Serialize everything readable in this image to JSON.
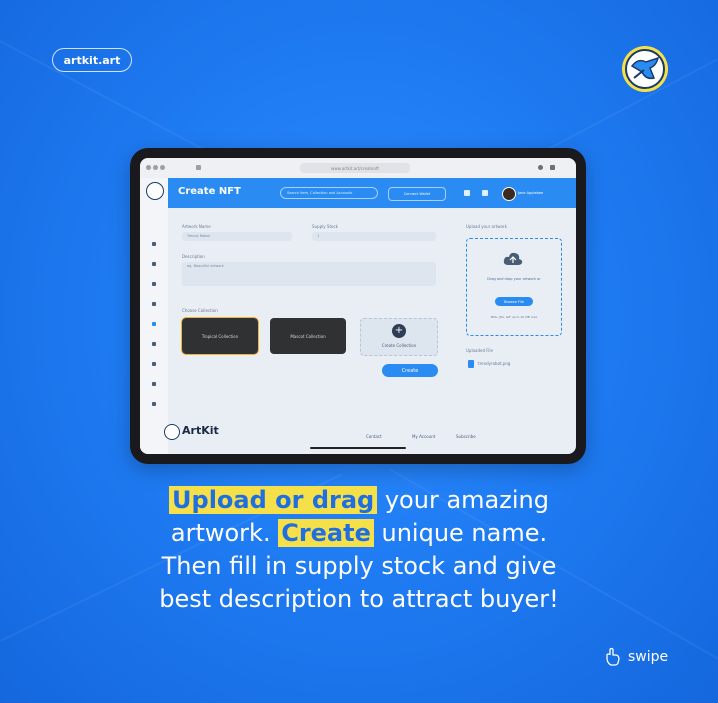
{
  "brand_badge": "artkit.art",
  "tablet": {
    "url_text": "www.artkit.art/createnft",
    "app_title": "Create NFT",
    "search_placeholder": "Search item, Collection and Accounts",
    "connect_wallet": "Connect Wallet",
    "user_name": "Jane Applebee",
    "form": {
      "artwork_name_label": "Artwork Name",
      "artwork_name_value": "Trendy Robot",
      "supply_label": "Supply Stock",
      "supply_value": "1",
      "description_label": "Description",
      "description_value": "eg. Beautiful artwork",
      "collection_label": "Choose Collection",
      "collection_1": "Tropical Collection",
      "collection_2": "Mascot Collection",
      "create_collection": "Create Collection",
      "create_button": "Create"
    },
    "upload": {
      "title": "Upload your artwork",
      "drag_text": "Drag and drop your artwork or",
      "browse_button": "Browse File",
      "note": "PNG, JPG, GIF up to 20 MB max",
      "uploaded_label": "Uploaded File",
      "file_name": "trendyrobot.png"
    },
    "footer": {
      "logo": "ArtKit",
      "link_1": "Contact",
      "link_2": "My Account",
      "link_3": "Subscribe"
    }
  },
  "headline": {
    "hl1": "Upload or drag",
    "t1": " your amazing",
    "t2": "artwork. ",
    "hl2": "Create",
    "t3": " unique name.",
    "line3": "Then fill in supply stock and give",
    "line4": "best description to attract buyer!"
  },
  "swipe_label": "swipe",
  "colors": {
    "background": "#1f7cf3",
    "highlight": "#f6e04a",
    "accent": "#2a8bf2"
  }
}
